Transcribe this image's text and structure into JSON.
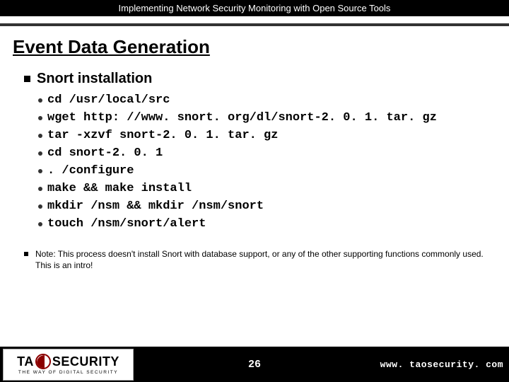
{
  "header": {
    "title": "Implementing Network Security Monitoring with Open Source Tools"
  },
  "slide": {
    "title": "Event Data Generation",
    "subheading": "Snort installation",
    "commands": [
      "cd /usr/local/src",
      "wget http: //www. snort. org/dl/snort-2. 0. 1. tar. gz",
      "tar -xzvf snort-2. 0. 1. tar. gz",
      "cd snort-2. 0. 1",
      ". /configure",
      "make && make install",
      "mkdir /nsm && mkdir /nsm/snort",
      "touch /nsm/snort/alert"
    ],
    "note": "Note: This process doesn't install Snort with database support, or any of the other supporting functions commonly used.  This is an intro!"
  },
  "footer": {
    "logo_main_left": "TA",
    "logo_main_right": "SECURITY",
    "logo_sub": "THE WAY OF DIGITAL SECURITY",
    "page": "26",
    "url": "www. taosecurity. com"
  }
}
